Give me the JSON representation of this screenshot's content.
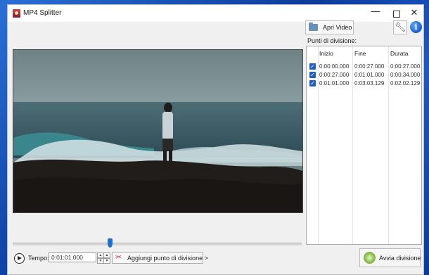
{
  "window": {
    "title": "MP4 Splitter",
    "controls": {
      "minimize": "—",
      "close": "✕"
    }
  },
  "toolbar": {
    "open_video_label": "Apri Video",
    "settings_icon": "wrench-icon",
    "info_icon": "info-icon",
    "info_glyph": "i"
  },
  "points": {
    "label": "Punti di divisione:",
    "columns": [
      "Inizio",
      "Fine",
      "Durata"
    ],
    "rows": [
      {
        "checked": true,
        "start": "0:00:00.000",
        "end": "0:00:27.000",
        "duration": "0:00:27.000"
      },
      {
        "checked": true,
        "start": "0:00:27.000",
        "end": "0:01:01.000",
        "duration": "0:00:34.000"
      },
      {
        "checked": true,
        "start": "0:01:01.000",
        "end": "0:03:03.129",
        "duration": "0:02:02.129"
      }
    ]
  },
  "timeline": {
    "position_fraction": 0.335
  },
  "controls": {
    "tempo_label": "Tempo:",
    "time_value": "0:01:01.000",
    "spin_up": "▲",
    "spin_down": "▼",
    "add_point_label": "Aggiungi punto di divisione >",
    "start_label": "Avvia divisione",
    "scissors_glyph": "✂"
  },
  "colors": {
    "accent": "#1f5fbf",
    "slider_thumb": "#1d6fd1",
    "desktop_bg": "#1b58c8"
  }
}
